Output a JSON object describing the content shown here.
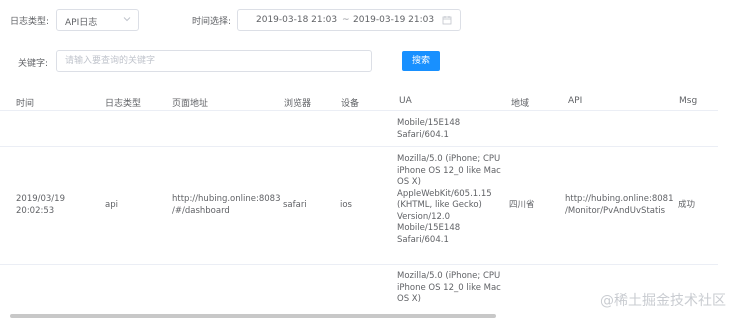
{
  "filters": {
    "log_type_label": "日志类型:",
    "log_type_value": "API日志",
    "time_label": "时间选择:",
    "start_date": "2019-03-18 21:03",
    "range_separator": "~",
    "end_date": "2019-03-19 21:03",
    "keyword_label": "关键字:",
    "keyword_placeholder": "请输入要查询的关键字",
    "search_button": "搜索"
  },
  "table": {
    "columns": [
      "时间",
      "日志类型",
      "页面地址",
      "浏览器",
      "设备",
      "UA",
      "地域",
      "API",
      "Msg"
    ],
    "rows": [
      {
        "ua": [
          "Mobile/15E148",
          "Safari/604.1"
        ]
      },
      {
        "time": [
          "2019/03/19",
          "20:02:53"
        ],
        "type": "api",
        "page_url": [
          "http://hubing.online:8083",
          "/#/dashboard"
        ],
        "browser": "safari",
        "device": "ios",
        "ua": [
          "Mozilla/5.0 (iPhone; CPU",
          "iPhone OS 12_0 like Mac",
          "OS X)",
          "AppleWebKit/605.1.15",
          "(KHTML, like Gecko)",
          "Version/12.0",
          "Mobile/15E148",
          "Safari/604.1"
        ],
        "region": "四川省",
        "api": [
          "http://hubing.online:8081",
          "/Monitor/PvAndUvStatis"
        ],
        "msg": "成功"
      },
      {
        "ua": [
          "Mozilla/5.0 (iPhone; CPU",
          "iPhone OS 12_0 like Mac",
          "OS X)"
        ]
      }
    ]
  },
  "watermark": "@稀土掘金技术社区",
  "colors": {
    "primary": "#1890ff",
    "border": "#dcdfe6",
    "text": "#606266"
  }
}
